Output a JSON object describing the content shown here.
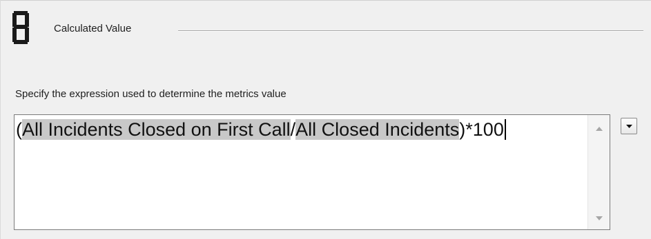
{
  "section": {
    "title": "Calculated Value",
    "icon": "calculator-digit-icon"
  },
  "description": "Specify the expression used to determine the metrics value",
  "expression": {
    "paren_open": "(",
    "operand_1": "All Incidents Closed on First Call",
    "operator": "/",
    "operand_2": "All Closed Incidents",
    "suffix": ")*100"
  },
  "scrollbar": {
    "up_icon": "scroll-up-arrow-icon",
    "down_icon": "scroll-down-arrow-icon"
  },
  "dropdown": {
    "icon": "chevron-down-icon"
  },
  "colors": {
    "background": "#f0f0f0",
    "text_box": "#ffffff",
    "highlight": "#c8c8c8",
    "text": "#1e1e1e"
  }
}
